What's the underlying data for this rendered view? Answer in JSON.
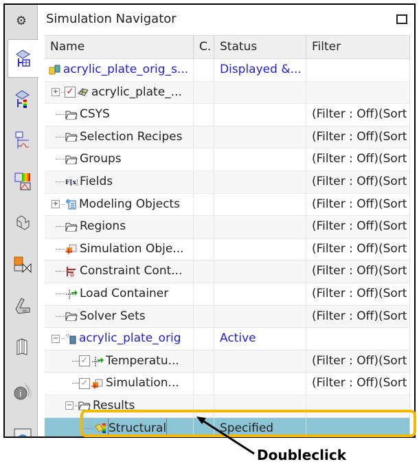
{
  "panel": {
    "title": "Simulation Navigator",
    "maximize_icon": "maximize-icon"
  },
  "sidebar": {
    "settings_icon": "gear-icon",
    "tabs": [
      {
        "icon": "simulation-navigator-icon",
        "active": true
      },
      {
        "icon": "post-processing-navigator-icon",
        "active": false
      },
      {
        "icon": "xy-function-navigator-icon",
        "active": false
      },
      {
        "icon": "fields-table-icon",
        "active": false
      },
      {
        "icon": "assembly-navigator-icon",
        "active": false
      },
      {
        "icon": "constraint-navigator-icon",
        "active": false
      },
      {
        "icon": "part-navigator-icon",
        "active": false
      },
      {
        "icon": "reuse-library-icon",
        "active": false
      },
      {
        "icon": "info-icon",
        "active": false
      },
      {
        "icon": "web-browser-icon",
        "active": false
      }
    ]
  },
  "columns": [
    "Name",
    "C.",
    "Status",
    "Filter"
  ],
  "rows": [
    {
      "name": "acrylic_plate_orig_s...",
      "status": "Displayed &...",
      "filter": "",
      "link": true,
      "icon": "sim-file-icon"
    },
    {
      "name": "acrylic_plate_...",
      "status": "",
      "filter": "",
      "icon": "fem-mesh-icon",
      "checked": true
    },
    {
      "name": "CSYS",
      "status": "",
      "filter": "(Filter : Off)(Sort",
      "icon": "folder-icon"
    },
    {
      "name": "Selection Recipes",
      "status": "",
      "filter": "(Filter : Off)(Sort",
      "icon": "folder-icon"
    },
    {
      "name": "Groups",
      "status": "",
      "filter": "(Filter : Off)(Sort",
      "icon": "folder-icon"
    },
    {
      "name": "Fields",
      "status": "",
      "filter": "(Filter : Off)(Sort",
      "icon": "fields-icon"
    },
    {
      "name": "Modeling Objects",
      "status": "",
      "filter": "(Filter : Off)(Sort",
      "icon": "modeling-objects-icon"
    },
    {
      "name": "Regions",
      "status": "",
      "filter": "(Filter : Off)(Sort",
      "icon": "folder-icon"
    },
    {
      "name": "Simulation Obje...",
      "status": "",
      "filter": "(Filter : Off)(Sort",
      "icon": "simulation-object-icon"
    },
    {
      "name": "Constraint Cont...",
      "status": "",
      "filter": "(Filter : Off)(Sort",
      "icon": "constraint-icon"
    },
    {
      "name": "Load Container",
      "status": "",
      "filter": "(Filter : Off)(Sort",
      "icon": "load-icon"
    },
    {
      "name": "Solver Sets",
      "status": "",
      "filter": "(Filter : Off)(Sort",
      "icon": "folder-icon"
    },
    {
      "name": "acrylic_plate_orig",
      "status": "Active",
      "filter": "",
      "link": true,
      "icon": "solution-icon"
    },
    {
      "name": "Temperatu...",
      "status": "",
      "filter": "(Filter : Off)(Sort",
      "icon": "load-icon",
      "checked": true
    },
    {
      "name": "Simulation...",
      "status": "",
      "filter": "(Filter : Off)(Sort",
      "icon": "simulation-object-icon",
      "checked": true
    },
    {
      "name": "Results",
      "status": "",
      "filter": "",
      "icon": "folder-icon"
    },
    {
      "name": "Structural",
      "status": "Specified",
      "filter": "",
      "icon": "results-icon",
      "selected": true
    }
  ],
  "annotation": {
    "label": "Doubleclick",
    "highlight_color": "#f5b800"
  }
}
